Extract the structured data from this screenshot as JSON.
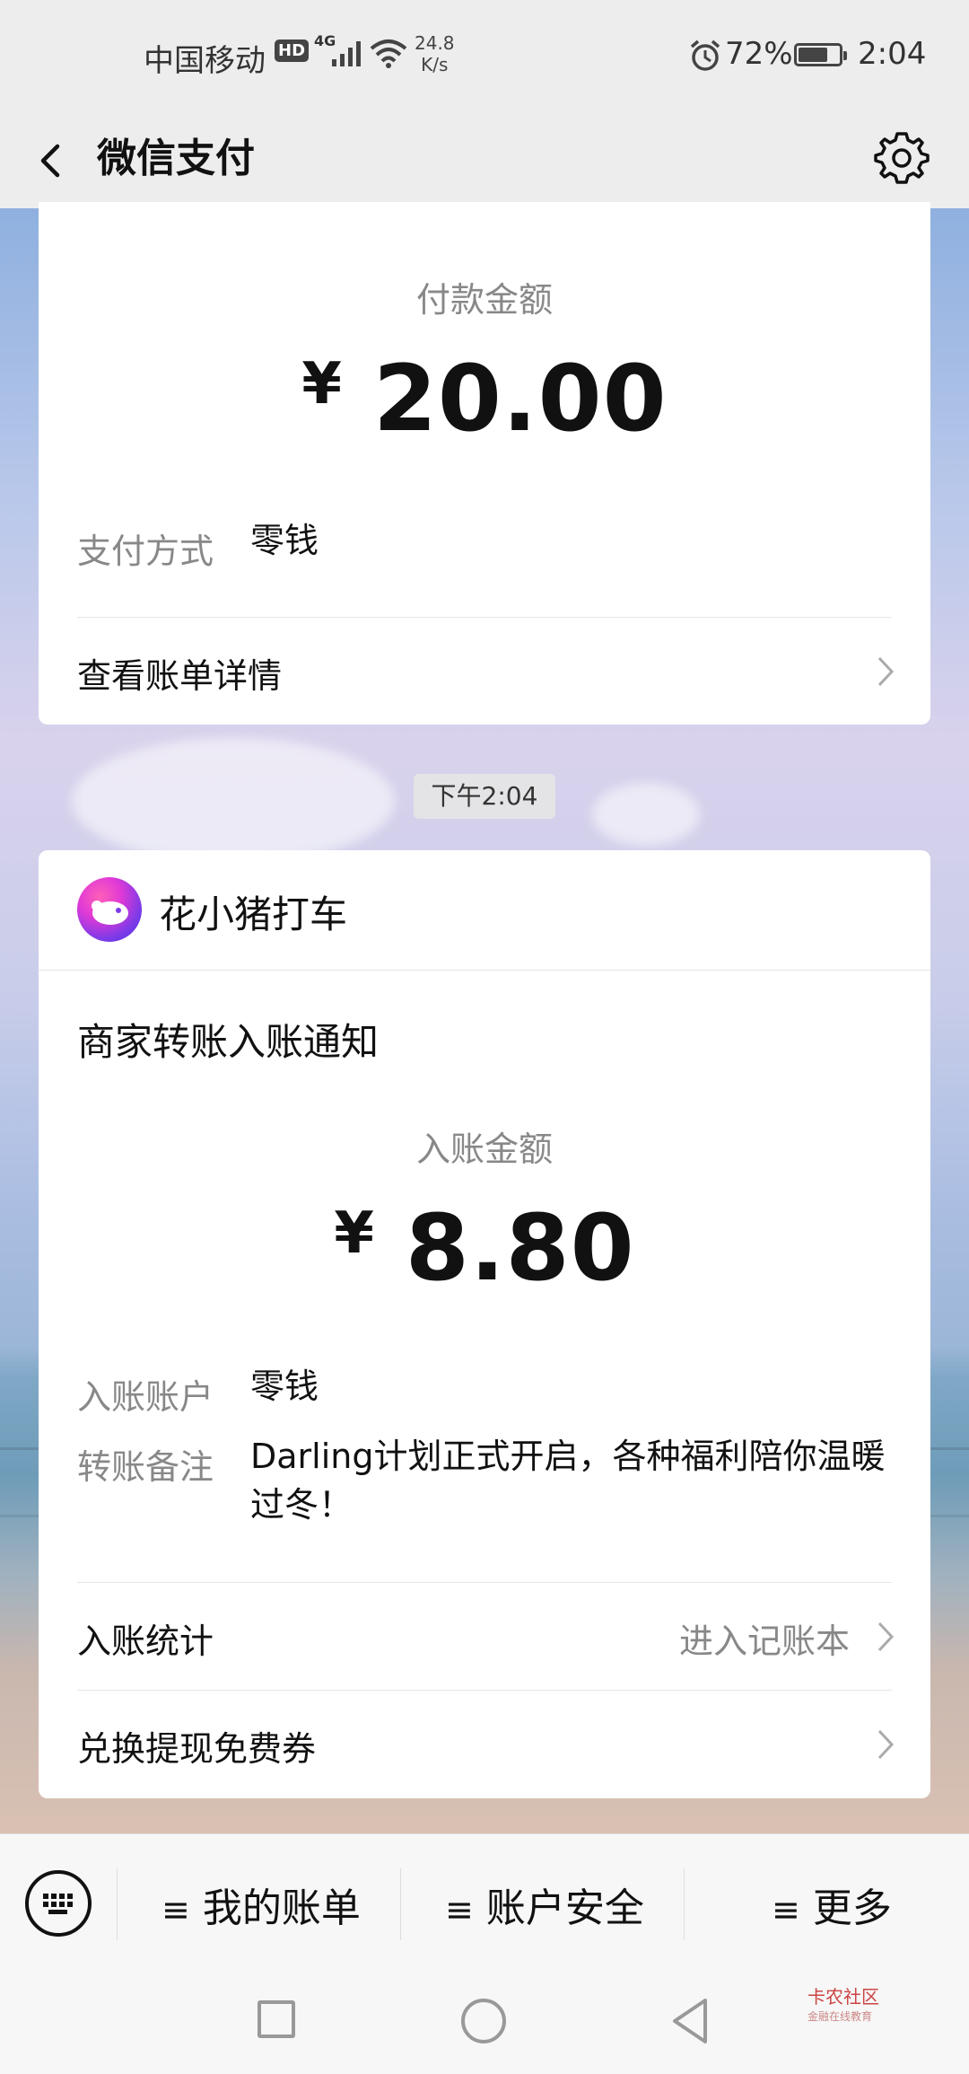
{
  "status_bar": {
    "carrier": "中国移动",
    "hd_badge": "HD",
    "network": "4G",
    "speed_value": "24.8",
    "speed_unit": "K/s",
    "battery_percent": "72%",
    "battery_level": 0.72,
    "time": "2:04"
  },
  "nav": {
    "title": "微信支付"
  },
  "payment_card": {
    "amount_label": "付款金额",
    "currency_symbol": "¥",
    "amount": "20.00",
    "method_label": "支付方式",
    "method_value": "零钱",
    "bill_detail_link": "查看账单详情"
  },
  "timestamp": "下午2:04",
  "transfer_card": {
    "merchant_name": "花小猪打车",
    "notice_title": "商家转账入账通知",
    "amount_label": "入账金额",
    "currency_symbol": "¥",
    "amount": "8.80",
    "account_label": "入账账户",
    "account_value": "零钱",
    "remark_label": "转账备注",
    "remark_value": "Darling计划正式开启，各种福利陪你温暖过冬！",
    "stats_label": "入账统计",
    "stats_link": "进入记账本",
    "coupon_link": "兑换提现免费券"
  },
  "bottom_menu": {
    "items": [
      {
        "label": "我的账单"
      },
      {
        "label": "账户安全"
      },
      {
        "label": "更多"
      }
    ],
    "menu_glyph": "≡"
  },
  "watermark": {
    "text": "卡农社区",
    "subtext": "金融在线教育"
  },
  "colors": {
    "card_bg": "#ffffff",
    "page_bg": "#ededed",
    "secondary_text": "#888888"
  }
}
